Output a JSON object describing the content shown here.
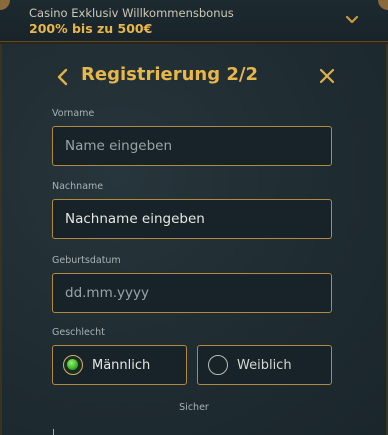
{
  "banner": {
    "line1": "Casino Exklusiv Willkommensbonus",
    "line2": "200% bis zu 500€",
    "chevron_icon": "chevron-down-icon"
  },
  "header": {
    "title": "Registrierung 2/2",
    "back_icon": "chevron-left-icon",
    "close_icon": "close-icon"
  },
  "form": {
    "first_name": {
      "label": "Vorname",
      "placeholder": "Name eingeben",
      "value": ""
    },
    "last_name": {
      "label": "Nachname",
      "placeholder": "Nachname eingeben",
      "value": "Nachname eingeben"
    },
    "birthdate": {
      "label": "Geburtsdatum",
      "placeholder": "dd.mm.yyyy",
      "value": ""
    },
    "gender": {
      "label": "Geschlecht",
      "options": [
        {
          "label": "Männlich",
          "selected": true
        },
        {
          "label": "Weiblich",
          "selected": false
        }
      ]
    }
  },
  "footer": {
    "secure_text": "Sicher",
    "partial_label": "L_"
  },
  "colors": {
    "accent": "#e8b74a",
    "border": "#b08a3e",
    "background": "#1f2d33",
    "selected_radio": "#3dbb2c"
  }
}
